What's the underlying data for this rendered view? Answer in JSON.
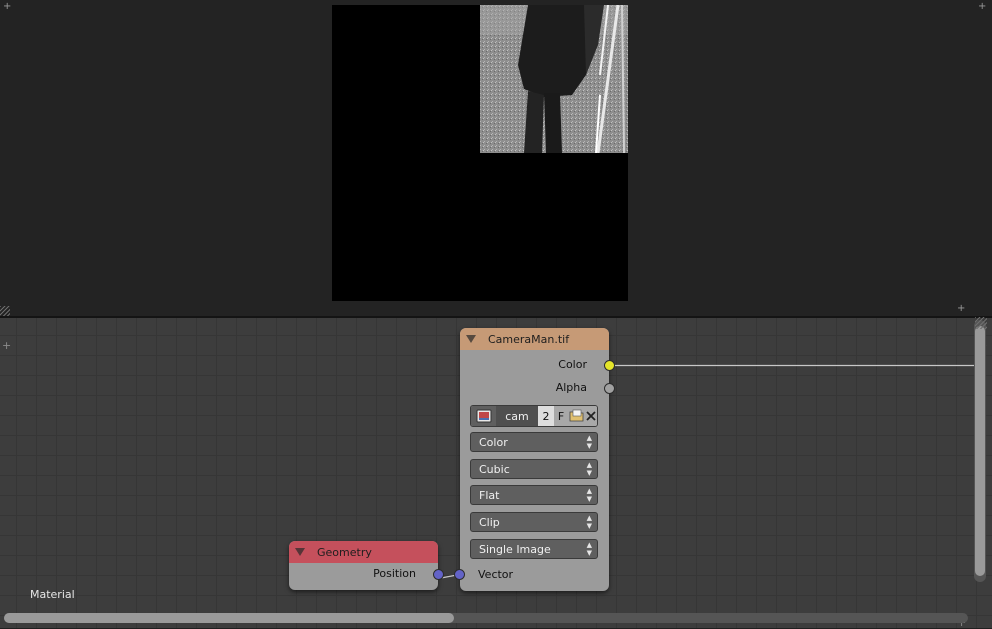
{
  "image_node": {
    "title": "CameraMan.tif",
    "header_color": "#c69a76",
    "outputs": [
      {
        "label": "Color",
        "socket_color": "#e5e52a"
      },
      {
        "label": "Alpha",
        "socket_color": "#a1a1a1"
      }
    ],
    "image_datablock": {
      "name": "cam",
      "users": "2",
      "fake_user": "F"
    },
    "dropdowns": [
      "Color",
      "Cubic",
      "Flat",
      "Clip",
      "Single Image"
    ],
    "input": {
      "label": "Vector",
      "socket_color": "#6363c7"
    }
  },
  "geometry_node": {
    "title": "Geometry",
    "header_color": "#c5505c",
    "outputs": [
      {
        "label": "Position",
        "socket_color": "#6363c7"
      }
    ]
  },
  "editor": {
    "label": "Material",
    "link_color": "#c8c8c8"
  },
  "icons": [
    "image-browse-icon",
    "file-open-icon",
    "unlink-x-icon",
    "collapse-triangle-icon",
    "area-corner-plus-icon"
  ]
}
